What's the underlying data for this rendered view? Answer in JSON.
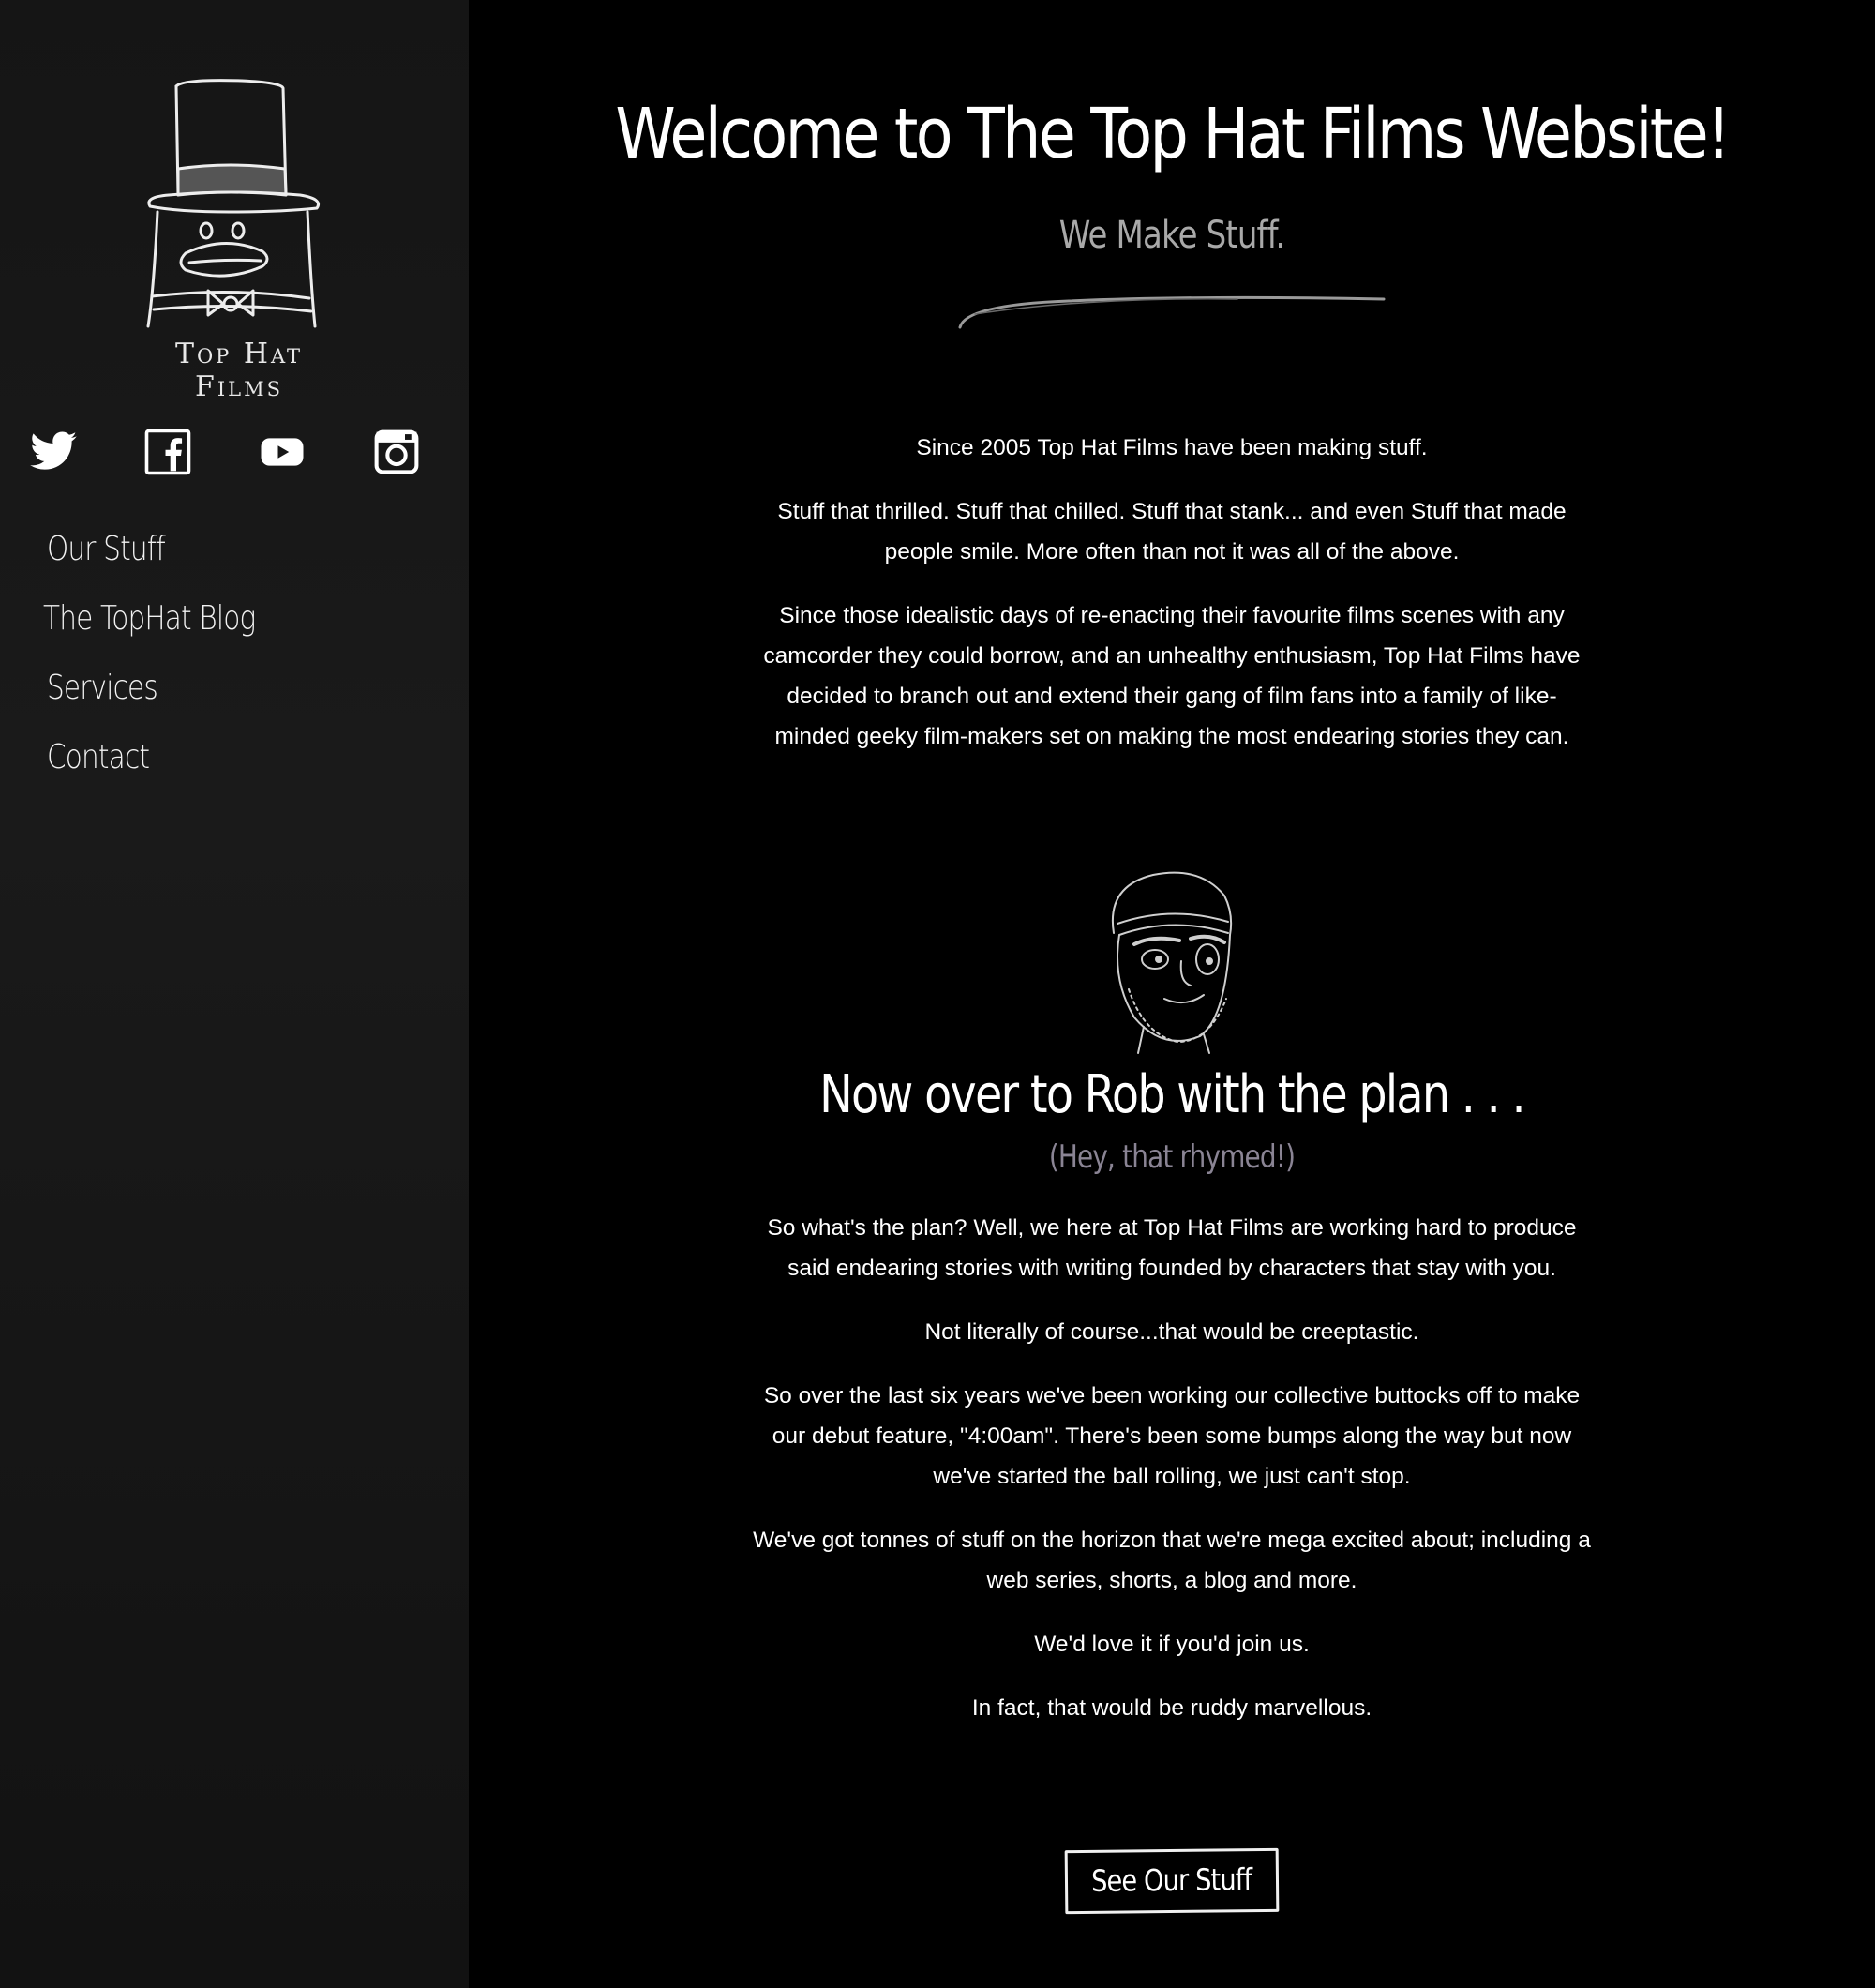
{
  "sidebar": {
    "logo_text": "Top Hat Films",
    "social": [
      {
        "icon": "twitter-icon"
      },
      {
        "icon": "facebook-icon"
      },
      {
        "icon": "youtube-icon"
      },
      {
        "icon": "instagram-icon"
      }
    ],
    "nav": [
      {
        "label": "Our Stuff"
      },
      {
        "label": "The TopHat Blog"
      },
      {
        "label": "Services"
      },
      {
        "label": "Contact"
      }
    ]
  },
  "main": {
    "title": "Welcome to The Top Hat Films Website!",
    "subtitle": "We Make Stuff.",
    "intro": [
      "Since 2005 Top Hat Films have been making stuff.",
      "Stuff that thrilled. Stuff that chilled. Stuff that stank... and even Stuff that made people smile. More often than not it was all of the above.",
      "Since those idealistic days of re-enacting their favourite films scenes with any camcorder they could borrow, and an unhealthy enthusiasm, Top Hat Films have decided to branch out and extend their gang of film fans into a family of like-minded geeky film-makers set on making the most endearing stories they can."
    ],
    "plan_title": "Now over to Rob with the plan . . .",
    "plan_subtitle": "(Hey, that rhymed!)",
    "plan": [
      "So what's the plan? Well, we here at Top Hat Films are working hard to produce said endearing stories with writing founded by characters that stay with you.",
      "Not literally of course...that would be creeptastic.",
      "So over the last six years we've been working our collective buttocks off to make our debut feature, \"4:00am\". There's been some bumps along the way but now we've started the ball rolling, we just can't stop.",
      "We've got tonnes of stuff on the horizon that we're mega excited about; including a web series, shorts, a blog and more.",
      "We'd love it if you'd join us.",
      "In fact, that would be ruddy marvellous."
    ],
    "cta_label": "See Our Stuff"
  },
  "colors": {
    "background": "#000000",
    "sidebar": "#161616",
    "text": "#ffffff",
    "subtitle": "#a9a9a9",
    "plan_subtitle": "#8a8494"
  }
}
